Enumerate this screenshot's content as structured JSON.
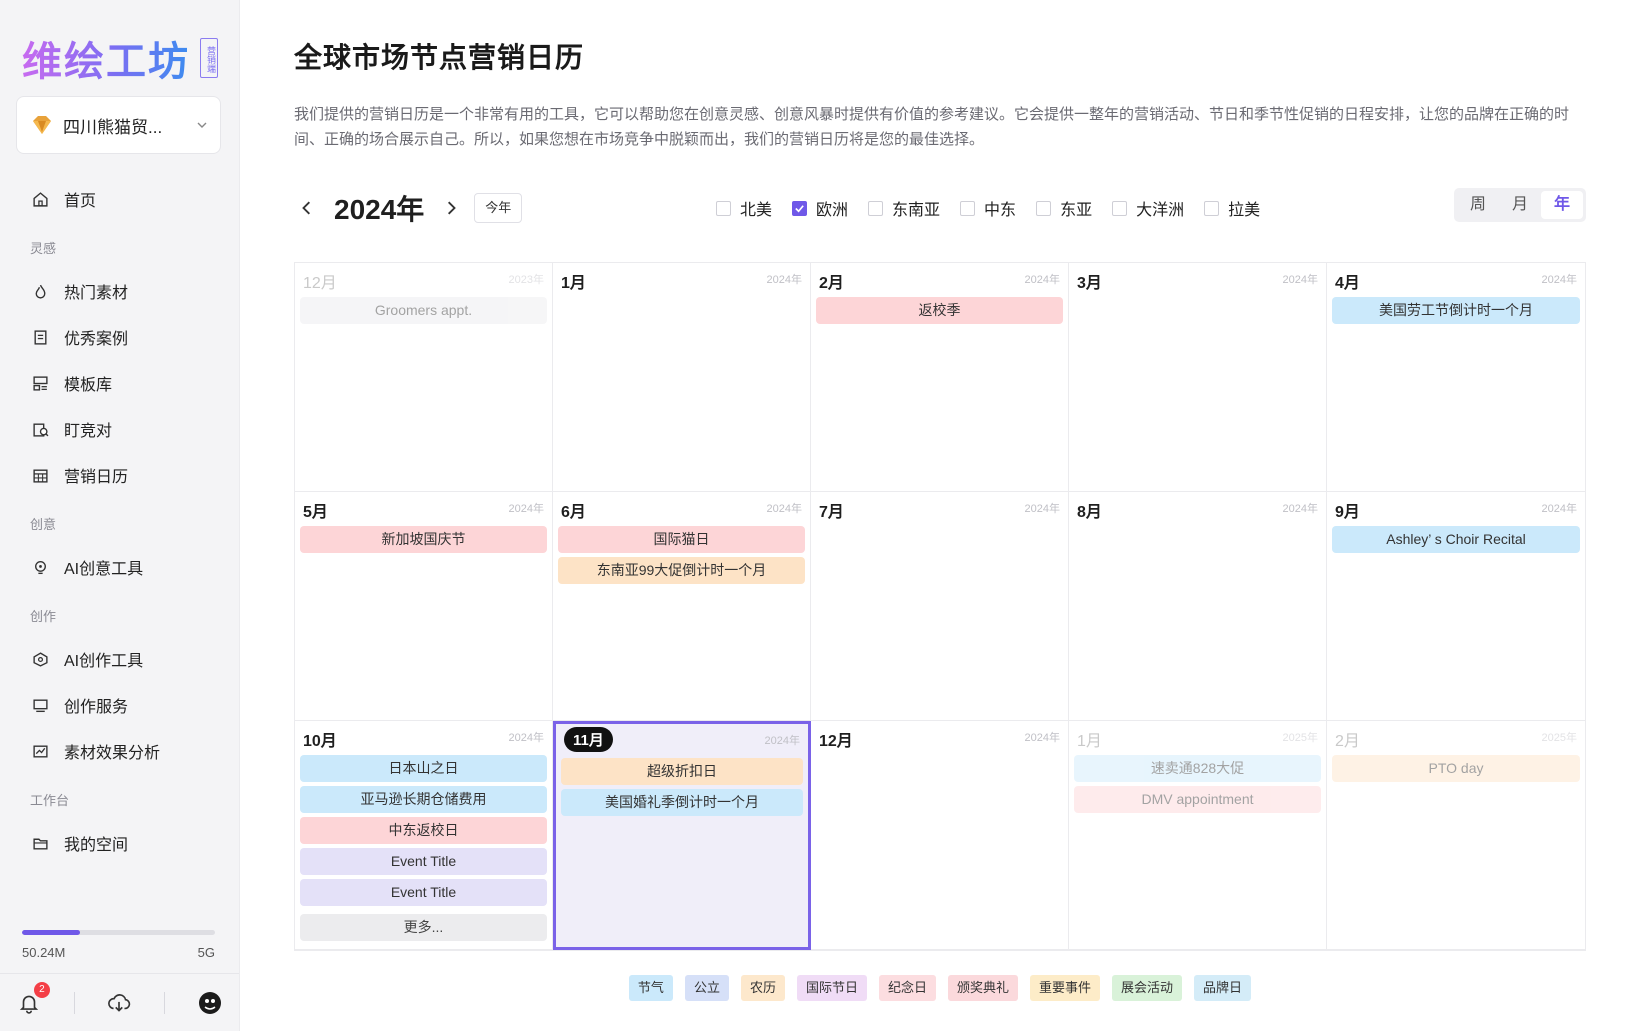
{
  "sidebar": {
    "logo_text": "维绘工坊",
    "logo_badge": "营销端",
    "company_name": "四川熊猫贸...",
    "nav": {
      "home": "首页",
      "section_inspiration": "灵感",
      "hot_materials": "热门素材",
      "cases": "优秀案例",
      "templates": "模板库",
      "competitors": "盯竞对",
      "calendar": "营销日历",
      "section_creative": "创意",
      "ai_creative": "AI创意工具",
      "section_create": "创作",
      "ai_create": "AI创作工具",
      "create_service": "创作服务",
      "material_analysis": "素材效果分析",
      "section_workbench": "工作台",
      "my_space": "我的空间"
    },
    "storage": {
      "used": "50.24M",
      "total": "5G",
      "fraction": 0.3
    },
    "notifications": "2"
  },
  "main": {
    "title": "全球市场节点营销日历",
    "description": "我们提供的营销日历是一个非常有用的工具，它可以帮助您在创意灵感、创意风暴时提供有价值的参考建议。它会提供一整年的营销活动、节日和季节性促销的日程安排，让您的品牌在正确的时间、正确的场合展示自己。所以，如果您想在市场竞争中脱颖而出，我们的营销日历将是您的最佳选择。",
    "year_label": "2024年",
    "today_label": "今年",
    "regions": [
      {
        "label": "北美",
        "checked": false
      },
      {
        "label": "欧洲",
        "checked": true
      },
      {
        "label": "东南亚",
        "checked": false
      },
      {
        "label": "中东",
        "checked": false
      },
      {
        "label": "东亚",
        "checked": false
      },
      {
        "label": "大洋洲",
        "checked": false
      },
      {
        "label": "拉美",
        "checked": false
      }
    ],
    "views": {
      "week": "周",
      "month": "月",
      "year": "年"
    },
    "months": [
      {
        "name": "12月",
        "year": "2023年",
        "faded": true,
        "events": [
          {
            "text": "Groomers appt.",
            "color": "gray"
          }
        ]
      },
      {
        "name": "1月",
        "year": "2024年",
        "events": []
      },
      {
        "name": "2月",
        "year": "2024年",
        "events": [
          {
            "text": "返校季",
            "color": "red"
          }
        ]
      },
      {
        "name": "3月",
        "year": "2024年",
        "events": []
      },
      {
        "name": "4月",
        "year": "2024年",
        "events": [
          {
            "text": "美国劳工节倒计时一个月",
            "color": "blue"
          }
        ]
      },
      {
        "name": "5月",
        "year": "2024年",
        "events": [
          {
            "text": "新加坡国庆节",
            "color": "red"
          }
        ]
      },
      {
        "name": "6月",
        "year": "2024年",
        "events": [
          {
            "text": "国际猫日",
            "color": "red"
          },
          {
            "text": "东南亚99大促倒计时一个月",
            "color": "orange"
          }
        ]
      },
      {
        "name": "7月",
        "year": "2024年",
        "events": []
      },
      {
        "name": "8月",
        "year": "2024年",
        "events": []
      },
      {
        "name": "9月",
        "year": "2024年",
        "events": [
          {
            "text": "Ashley’ s Choir Recital",
            "color": "blue"
          }
        ]
      },
      {
        "name": "10月",
        "year": "2024年",
        "events": [
          {
            "text": "日本山之日",
            "color": "blue"
          },
          {
            "text": "亚马逊长期仓储费用",
            "color": "blue"
          },
          {
            "text": "中东返校日",
            "color": "red"
          },
          {
            "text": "Event Title",
            "color": "purple"
          },
          {
            "text": "Event Title",
            "color": "purple"
          }
        ],
        "more": "更多..."
      },
      {
        "name": "11月",
        "year": "2024年",
        "current": true,
        "events": [
          {
            "text": "超级折扣日",
            "color": "orange"
          },
          {
            "text": "美国婚礼季倒计时一个月",
            "color": "blue"
          }
        ]
      },
      {
        "name": "12月",
        "year": "2024年",
        "events": []
      },
      {
        "name": "1月",
        "year": "2025年",
        "faded": true,
        "events": [
          {
            "text": "速卖通828大促",
            "color": "blue"
          },
          {
            "text": "DMV appointment",
            "color": "red"
          }
        ]
      },
      {
        "name": "2月",
        "year": "2025年",
        "faded": true,
        "events": [
          {
            "text": "PTO day",
            "color": "orange"
          }
        ]
      }
    ],
    "legend": [
      {
        "label": "节气",
        "color": "#cbe9fb"
      },
      {
        "label": "公立",
        "color": "#d6e0f8"
      },
      {
        "label": "农历",
        "color": "#fde8cc"
      },
      {
        "label": "国际节日",
        "color": "#f0dcf6"
      },
      {
        "label": "纪念日",
        "color": "#fcdde0"
      },
      {
        "label": "颁奖典礼",
        "color": "#fbd9dc"
      },
      {
        "label": "重要事件",
        "color": "#fdecc8"
      },
      {
        "label": "展会活动",
        "color": "#d9f2d9"
      },
      {
        "label": "品牌日",
        "color": "#d4ecf8"
      }
    ]
  }
}
